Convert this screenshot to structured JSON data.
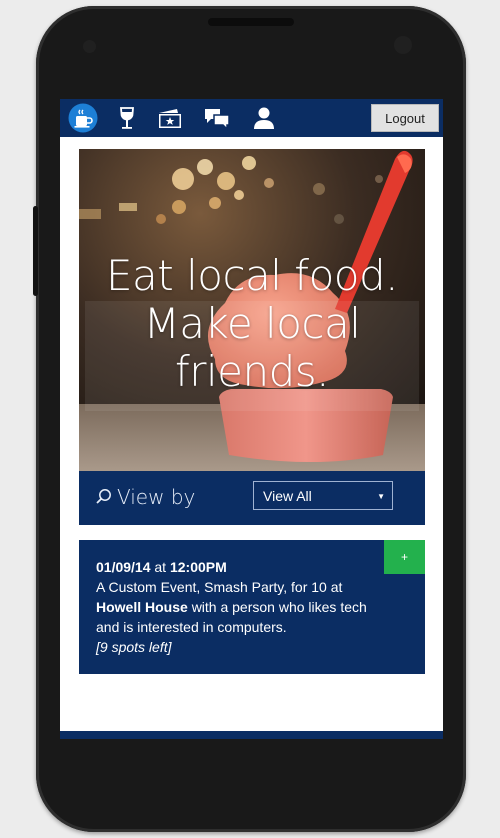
{
  "nav": {
    "icons": [
      "coffee-icon",
      "wine-glass-icon",
      "ticket-icon",
      "chat-icon",
      "user-icon"
    ],
    "logout_label": "Logout",
    "colors": {
      "bar": "#0b2d63",
      "active_circle": "#1d7fd6",
      "button": "#e2e2e2"
    }
  },
  "hero": {
    "title": "Eat local food. Make local friends."
  },
  "filter": {
    "label": "View by",
    "selected": "View All"
  },
  "events": [
    {
      "date": "01/09/14",
      "at": "at",
      "time": "12:00PM",
      "line1": "A Custom Event, Smash Party, for 10 at",
      "venue": "Howell House",
      "line2": "with a person who likes tech and is interested in computers.",
      "spots": "[9 spots left]",
      "add_label": "+",
      "colors": {
        "card": "#0b2d63",
        "add_button": "#23b14d"
      }
    }
  ]
}
